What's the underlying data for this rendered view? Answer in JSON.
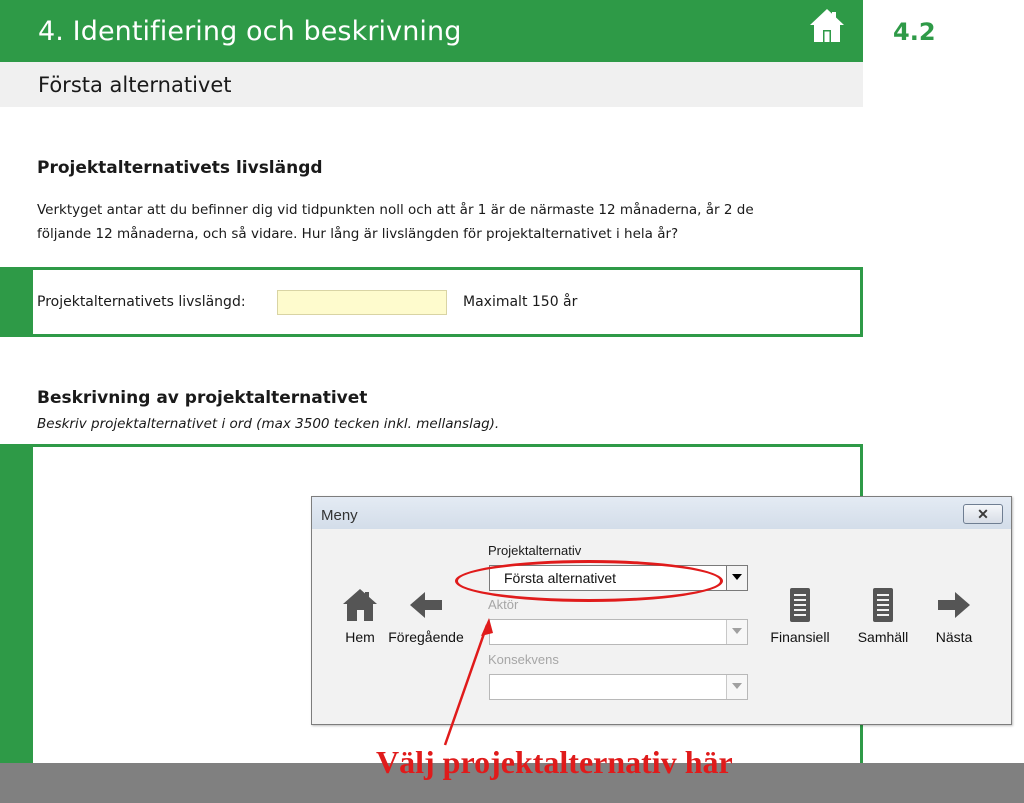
{
  "header": {
    "title": "4. Identifiering och beskrivning",
    "section_number": "4.2",
    "home_icon": "home-icon"
  },
  "subheader": {
    "title": "Första alternativet"
  },
  "lifespan_section": {
    "heading": "Projektalternativets livslängd",
    "intro_line1": "Verktyget antar att du befinner dig vid tidpunkten noll och att år 1 är de närmaste 12 månaderna, år 2 de",
    "intro_line2": "följande 12 månaderna, och så vidare. Hur lång är livslängden för projektalternativet i hela år?",
    "field_label": "Projektalternativets livslängd:",
    "field_value": "",
    "max_note": "Maximalt 150 år"
  },
  "description_section": {
    "heading": "Beskrivning av projektalternativet",
    "subheading": "Beskriv projektalternativet i ord (max 3500 tecken inkl. mellanslag).",
    "text_value": ""
  },
  "menu_dialog": {
    "title": "Meny",
    "close_glyph": "✕",
    "project_label": "Projektalternativ",
    "project_selected": "Första alternativet",
    "actor_label": "Aktör",
    "actor_selected": "",
    "consequence_label": "Konsekvens",
    "consequence_selected": "",
    "nav_buttons": {
      "home": "Hem",
      "previous": "Föregående",
      "financial": "Finansiell",
      "societal": "Samhäll",
      "next": "Nästa"
    }
  },
  "annotation": {
    "text": "Välj projektalternativ här"
  },
  "colors": {
    "brand_green": "#2e9a47",
    "input_yellow": "#fefbcd",
    "annotation_red": "#e01b1b",
    "icon_gray": "#555555"
  }
}
